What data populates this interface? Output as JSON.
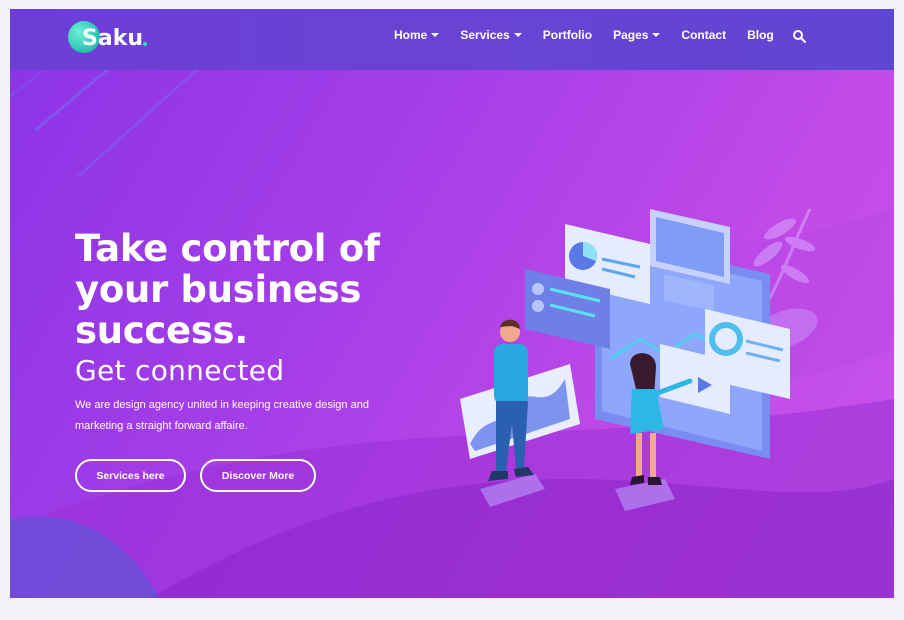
{
  "logo": {
    "text": "Saku"
  },
  "nav": {
    "items": [
      {
        "label": "Home",
        "dropdown": true
      },
      {
        "label": "Services",
        "dropdown": true
      },
      {
        "label": "Portfolio",
        "dropdown": false
      },
      {
        "label": "Pages",
        "dropdown": true
      },
      {
        "label": "Contact",
        "dropdown": false
      },
      {
        "label": "Blog",
        "dropdown": false
      }
    ],
    "search_icon": "search-icon"
  },
  "hero": {
    "headline_line1": "Take control of",
    "headline_line2": "your business",
    "headline_line3": "success.",
    "subheadline": "Get connected",
    "description_line1": "We are design agency united in keeping creative design and",
    "description_line2": "marketing a straight forward affaire.",
    "primary_button": "Services here",
    "secondary_button": "Discover More"
  },
  "colors": {
    "navbar": "#6a43d4",
    "hero_start": "#8a34e6",
    "hero_end": "#c555ea",
    "logo_accent": "#2fc8b4",
    "illustration_accent": "#2a9be0"
  }
}
